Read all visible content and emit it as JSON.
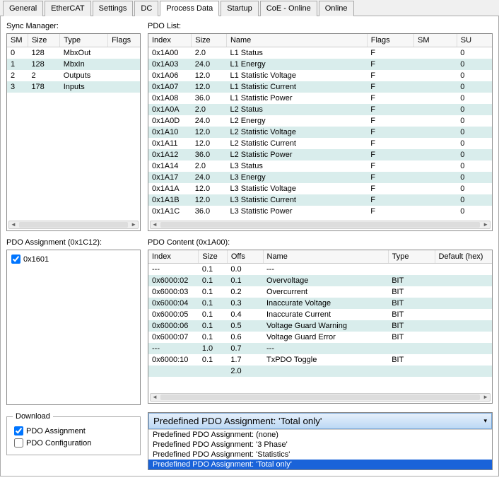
{
  "tabs": [
    "General",
    "EtherCAT",
    "Settings",
    "DC",
    "Process Data",
    "Startup",
    "CoE - Online",
    "Online"
  ],
  "active_tab": "Process Data",
  "sync_manager": {
    "label": "Sync Manager:",
    "headers": [
      "SM",
      "Size",
      "Type",
      "Flags"
    ],
    "rows": [
      {
        "sm": "0",
        "size": "128",
        "type": "MbxOut",
        "flags": ""
      },
      {
        "sm": "1",
        "size": "128",
        "type": "MbxIn",
        "flags": ""
      },
      {
        "sm": "2",
        "size": "2",
        "type": "Outputs",
        "flags": ""
      },
      {
        "sm": "3",
        "size": "178",
        "type": "Inputs",
        "flags": ""
      }
    ],
    "selected": 1
  },
  "pdo_list": {
    "label": "PDO List:",
    "headers": [
      "Index",
      "Size",
      "Name",
      "Flags",
      "SM",
      "SU"
    ],
    "rows": [
      {
        "index": "0x1A00",
        "size": "2.0",
        "name": "L1 Status",
        "flags": "F",
        "sm": "",
        "su": "0"
      },
      {
        "index": "0x1A03",
        "size": "24.0",
        "name": "L1 Energy",
        "flags": "F",
        "sm": "",
        "su": "0"
      },
      {
        "index": "0x1A06",
        "size": "12.0",
        "name": "L1 Statistic Voltage",
        "flags": "F",
        "sm": "",
        "su": "0"
      },
      {
        "index": "0x1A07",
        "size": "12.0",
        "name": "L1 Statistic Current",
        "flags": "F",
        "sm": "",
        "su": "0"
      },
      {
        "index": "0x1A08",
        "size": "36.0",
        "name": "L1 Statistic Power",
        "flags": "F",
        "sm": "",
        "su": "0"
      },
      {
        "index": "0x1A0A",
        "size": "2.0",
        "name": "L2 Status",
        "flags": "F",
        "sm": "",
        "su": "0"
      },
      {
        "index": "0x1A0D",
        "size": "24.0",
        "name": "L2 Energy",
        "flags": "F",
        "sm": "",
        "su": "0"
      },
      {
        "index": "0x1A10",
        "size": "12.0",
        "name": "L2 Statistic Voltage",
        "flags": "F",
        "sm": "",
        "su": "0"
      },
      {
        "index": "0x1A11",
        "size": "12.0",
        "name": "L2 Statistic Current",
        "flags": "F",
        "sm": "",
        "su": "0"
      },
      {
        "index": "0x1A12",
        "size": "36.0",
        "name": "L2 Statistic Power",
        "flags": "F",
        "sm": "",
        "su": "0"
      },
      {
        "index": "0x1A14",
        "size": "2.0",
        "name": "L3 Status",
        "flags": "F",
        "sm": "",
        "su": "0"
      },
      {
        "index": "0x1A17",
        "size": "24.0",
        "name": "L3 Energy",
        "flags": "F",
        "sm": "",
        "su": "0"
      },
      {
        "index": "0x1A1A",
        "size": "12.0",
        "name": "L3 Statistic Voltage",
        "flags": "F",
        "sm": "",
        "su": "0"
      },
      {
        "index": "0x1A1B",
        "size": "12.0",
        "name": "L3 Statistic Current",
        "flags": "F",
        "sm": "",
        "su": "0"
      },
      {
        "index": "0x1A1C",
        "size": "36.0",
        "name": "L3 Statistic Power",
        "flags": "F",
        "sm": "",
        "su": "0"
      }
    ]
  },
  "pdo_assignment": {
    "label": "PDO Assignment (0x1C12):",
    "items": [
      {
        "label": "0x1601",
        "checked": true
      }
    ]
  },
  "pdo_content": {
    "label": "PDO Content (0x1A00):",
    "headers": [
      "Index",
      "Size",
      "Offs",
      "Name",
      "Type",
      "Default (hex)"
    ],
    "rows": [
      {
        "index": "---",
        "size": "0.1",
        "offs": "0.0",
        "name": "---",
        "type": "",
        "def": ""
      },
      {
        "index": "0x6000:02",
        "size": "0.1",
        "offs": "0.1",
        "name": "Overvoltage",
        "type": "BIT",
        "def": ""
      },
      {
        "index": "0x6000:03",
        "size": "0.1",
        "offs": "0.2",
        "name": "Overcurrent",
        "type": "BIT",
        "def": ""
      },
      {
        "index": "0x6000:04",
        "size": "0.1",
        "offs": "0.3",
        "name": "Inaccurate Voltage",
        "type": "BIT",
        "def": ""
      },
      {
        "index": "0x6000:05",
        "size": "0.1",
        "offs": "0.4",
        "name": "Inaccurate Current",
        "type": "BIT",
        "def": ""
      },
      {
        "index": "0x6000:06",
        "size": "0.1",
        "offs": "0.5",
        "name": "Voltage Guard Warning",
        "type": "BIT",
        "def": ""
      },
      {
        "index": "0x6000:07",
        "size": "0.1",
        "offs": "0.6",
        "name": "Voltage Guard Error",
        "type": "BIT",
        "def": ""
      },
      {
        "index": "---",
        "size": "1.0",
        "offs": "0.7",
        "name": "---",
        "type": "",
        "def": ""
      },
      {
        "index": "0x6000:10",
        "size": "0.1",
        "offs": "1.7",
        "name": "TxPDO Toggle",
        "type": "BIT",
        "def": ""
      },
      {
        "index": "",
        "size": "",
        "offs": "2.0",
        "name": "",
        "type": "",
        "def": ""
      }
    ]
  },
  "download": {
    "legend": "Download",
    "items": [
      {
        "label": "PDO Assignment",
        "checked": true
      },
      {
        "label": "PDO Configuration",
        "checked": false
      }
    ]
  },
  "predef": {
    "button_label": "Predefined PDO Assignment: 'Total only'",
    "options": [
      "Predefined PDO Assignment: (none)",
      "Predefined PDO Assignment: '3 Phase'",
      "Predefined PDO Assignment: 'Statistics'",
      "Predefined PDO Assignment: 'Total only'"
    ],
    "selected": 3
  }
}
